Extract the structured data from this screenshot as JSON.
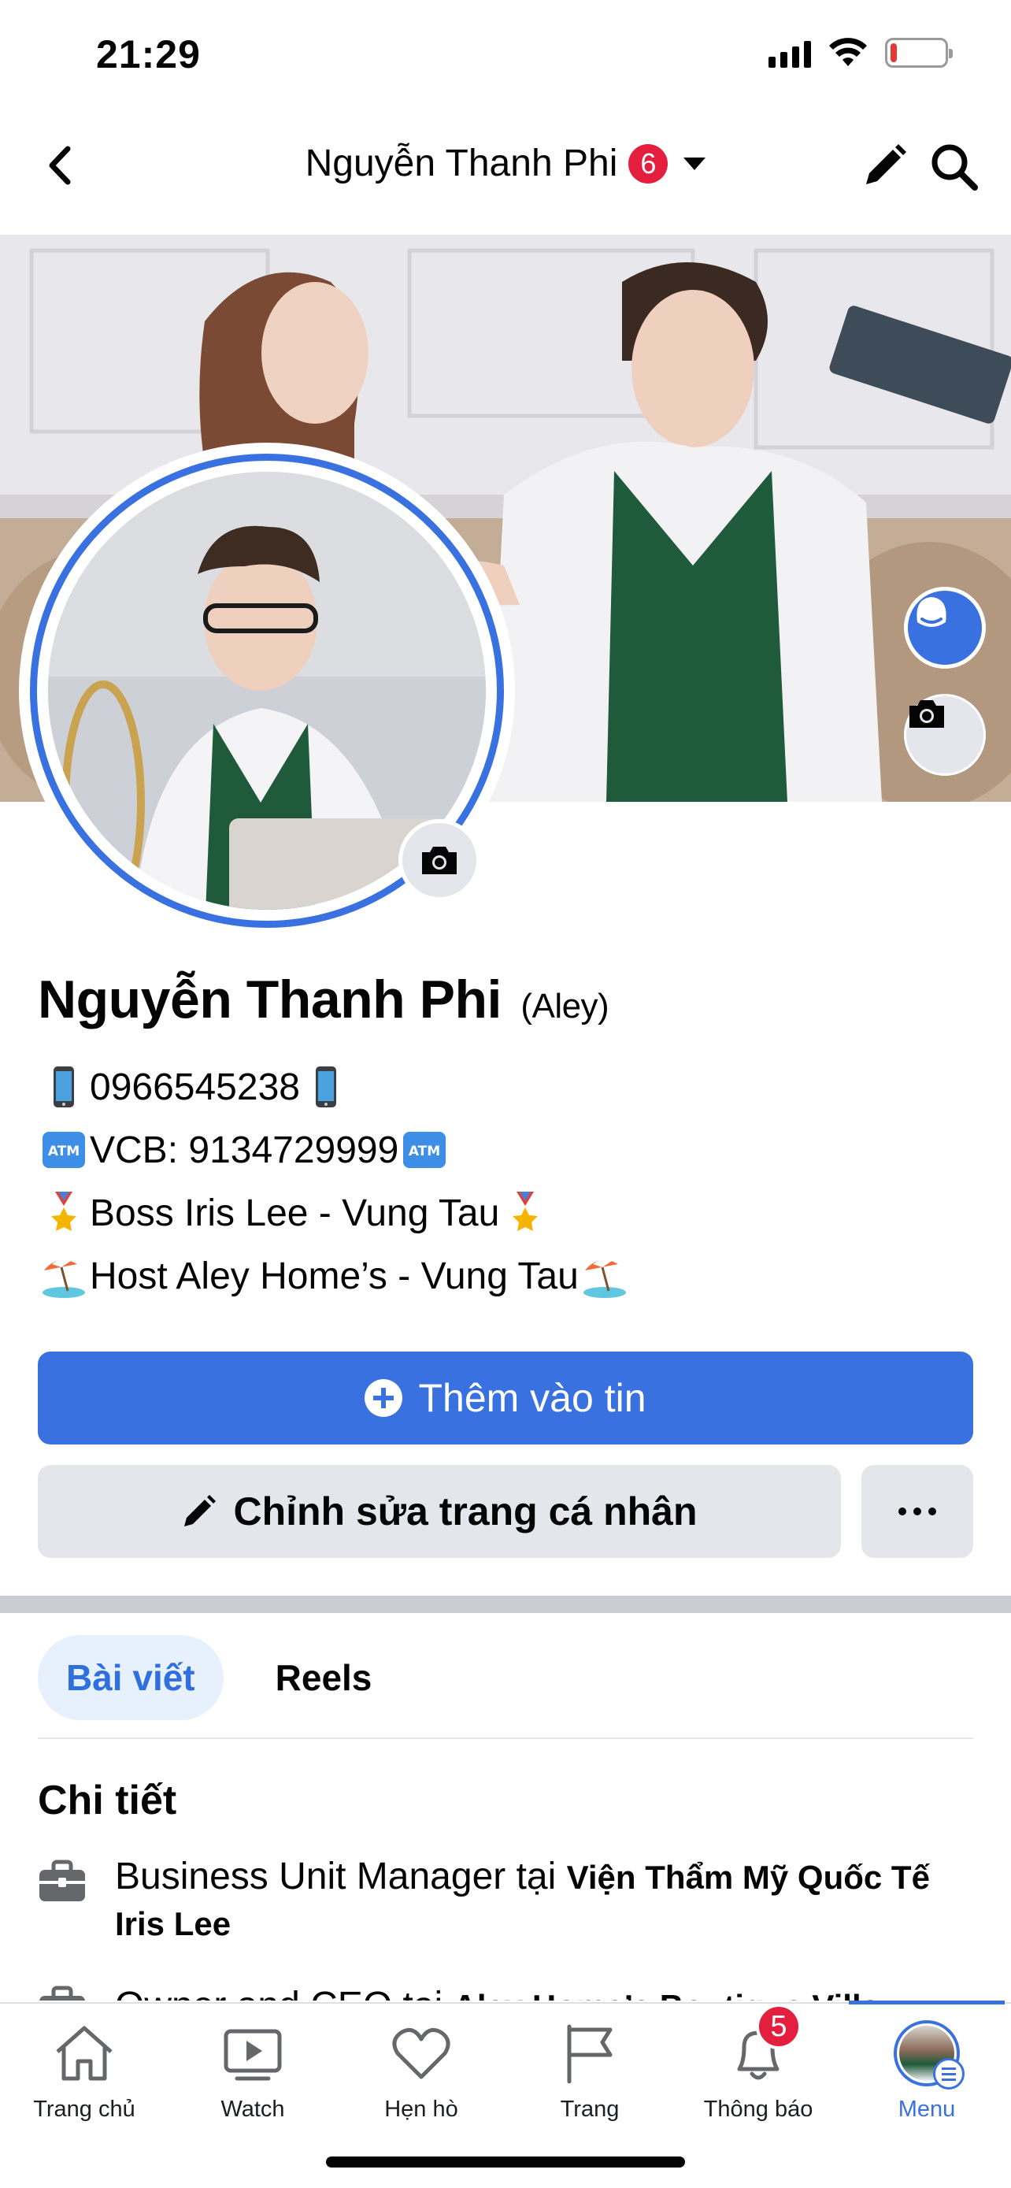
{
  "status_bar": {
    "time": "21:29",
    "battery_level": 0.12,
    "battery_color": "#e53935"
  },
  "nav": {
    "title": "Nguyễn Thanh Phi",
    "badge_count": "6",
    "icons": [
      "back-chevron-icon",
      "caret-down-icon",
      "pencil-icon",
      "search-icon"
    ]
  },
  "profile": {
    "name": "Nguyễn Thanh Phi",
    "alias": "(Aley)",
    "bio": [
      {
        "emoji_left": "mobile-phone",
        "text": "0966545238",
        "emoji_right": "mobile-phone"
      },
      {
        "emoji_left": "atm-sign",
        "text": "VCB: 9134729999",
        "emoji_right": "atm-sign"
      },
      {
        "emoji_left": "military-medal",
        "text": "Boss Iris Lee - Vung Tau",
        "emoji_right": "military-medal"
      },
      {
        "emoji_left": "beach-umbrella",
        "text": "Host Aley Home’s - Vung Tau",
        "emoji_right": "beach-umbrella"
      }
    ]
  },
  "actions": {
    "add_story_label": "Thêm vào tin",
    "edit_profile_label": "Chỉnh sửa trang cá nhân"
  },
  "tabs": [
    {
      "label": "Bài viết",
      "active": true
    },
    {
      "label": "Reels",
      "active": false
    }
  ],
  "details": {
    "title": "Chi tiết",
    "items": [
      {
        "prefix": "Business Unit Manager tại ",
        "org": "Viện Thẩm Mỹ Quốc Tế Iris Lee"
      },
      {
        "prefix": "Owner and CEO tại ",
        "org": "Aley Home’s Boutique Villa"
      }
    ]
  },
  "bottom_nav": [
    {
      "label": "Trang chủ",
      "icon": "home-icon",
      "active": false
    },
    {
      "label": "Watch",
      "icon": "watch-play-icon",
      "active": false
    },
    {
      "label": "Hẹn hò",
      "icon": "heart-icon",
      "active": false
    },
    {
      "label": "Trang",
      "icon": "flag-icon",
      "active": false
    },
    {
      "label": "Thông báo",
      "icon": "bell-icon",
      "active": false,
      "badge": "5"
    },
    {
      "label": "Menu",
      "icon": "menu-avatar-icon",
      "active": true
    }
  ],
  "colors": {
    "accent": "#3a71e0",
    "badge": "#e41e3f",
    "secondary_button": "#e4e6eb",
    "active_tab_bg": "#e7f0fd"
  }
}
